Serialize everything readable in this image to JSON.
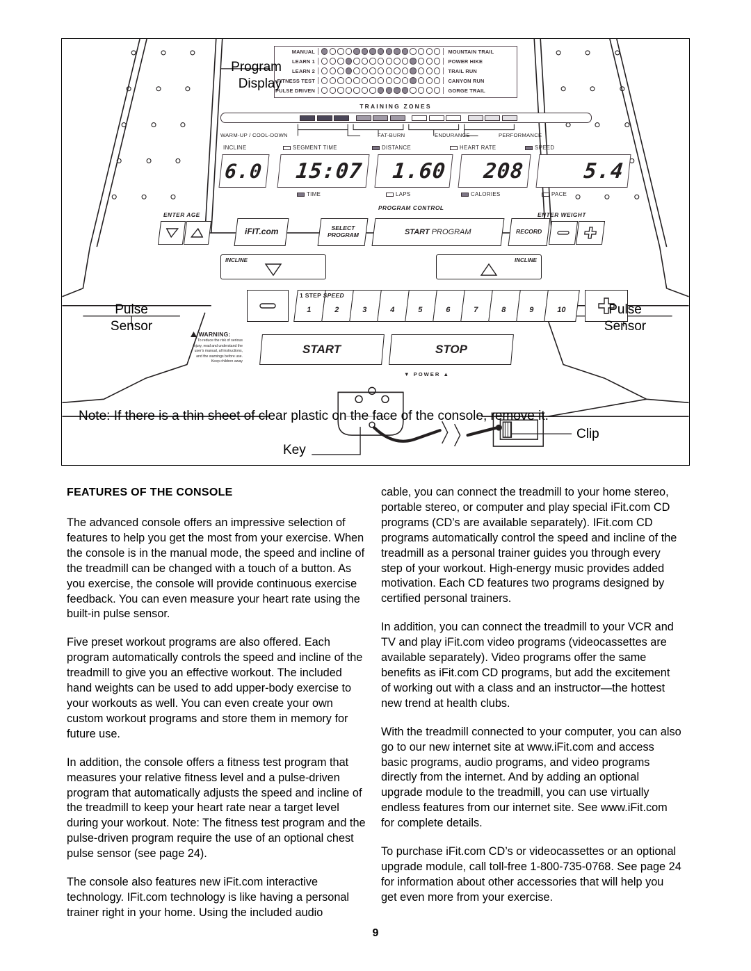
{
  "page": {
    "number": "9"
  },
  "heading": "FEATURES OF THE CONSOLE",
  "diagram": {
    "labels": {
      "program_display_line1": "Program",
      "program_display_line2": "Display",
      "pulse_sensor_line1": "Pulse",
      "pulse_sensor_line2": "Sensor",
      "key": "Key",
      "clip": "Clip"
    },
    "note": "Note: If there is a thin sheet of clear plastic on the face of the console, remove it.",
    "program_display": {
      "left_labels": [
        "MANUAL",
        "LEARN 1",
        "LEARN 2",
        "FITNESS TEST",
        "PULSE DRIVEN"
      ],
      "right_labels": [
        "MOUNTAIN TRAIL",
        "POWER HIKE",
        "TRAIL RUN",
        "CANYON RUN",
        "GORGE TRAIL"
      ],
      "matrix": [
        [
          1,
          0,
          0,
          0,
          1,
          1,
          1,
          1,
          1,
          1,
          1,
          0,
          0,
          0,
          0
        ],
        [
          0,
          0,
          0,
          1,
          0,
          0,
          0,
          0,
          0,
          0,
          0,
          1,
          0,
          0,
          0
        ],
        [
          0,
          0,
          0,
          1,
          0,
          0,
          0,
          0,
          0,
          0,
          0,
          1,
          0,
          0,
          0
        ],
        [
          0,
          0,
          0,
          0,
          0,
          0,
          0,
          0,
          0,
          0,
          0,
          1,
          0,
          0,
          0
        ],
        [
          0,
          0,
          0,
          0,
          0,
          0,
          0,
          1,
          1,
          1,
          1,
          0,
          0,
          0,
          0
        ]
      ]
    },
    "training_zones": {
      "title": "TRAINING ZONES",
      "zones": [
        "WARM-UP / COOL-DOWN",
        "FAT-BURN",
        "ENDURANCE",
        "PERFORMANCE"
      ]
    },
    "readouts": {
      "top": [
        {
          "label": "INCLINE",
          "indicator": "none"
        },
        {
          "label": "SEGMENT TIME",
          "indicator": "hollow"
        },
        {
          "label": "DISTANCE",
          "indicator": "filled"
        },
        {
          "label": "HEART RATE",
          "indicator": "hollow"
        },
        {
          "label": "SPEED",
          "indicator": "filled"
        }
      ],
      "bottom": [
        {
          "label": "",
          "indicator": "none"
        },
        {
          "label": "TIME",
          "indicator": "filled"
        },
        {
          "label": "LAPS",
          "indicator": "hollow"
        },
        {
          "label": "CALORIES",
          "indicator": "filled"
        },
        {
          "label": "PACE",
          "indicator": "hollow"
        }
      ],
      "values": [
        "6.0",
        "15:07",
        "1.60",
        "208",
        "5.4"
      ]
    },
    "controls": {
      "enter_age_caption": "ENTER AGE",
      "enter_weight_caption": "ENTER WEIGHT",
      "program_control_caption": "PROGRAM CONTROL",
      "ifit_logo": "iFIT.com",
      "select_program_line1": "SELECT",
      "select_program_line2": "PROGRAM",
      "start_program_bold": "START",
      "start_program_rest": " PROGRAM",
      "record": "RECORD",
      "incline_left": "INCLINE",
      "incline_right": "INCLINE",
      "step_speed_prefix": "1 STEP",
      "step_speed_word": "SPEED",
      "speed_buttons": [
        "1",
        "2",
        "3",
        "4",
        "5",
        "6",
        "7",
        "8",
        "9",
        "10"
      ],
      "start": "START",
      "stop": "STOP",
      "power": "POWER"
    },
    "warning": {
      "title": "WARNING:",
      "body": "To reduce the risk of serious injury, read and understand the user's manual, all instructions, and the warnings before use.  Keep children away"
    }
  },
  "body": {
    "left_column": [
      "The advanced console offers an impressive selection of features to help you get the most from your exercise. When the console is in the manual mode, the speed and incline of the treadmill can be changed with a touch of a button. As you exercise, the console will provide continuous exercise feedback. You can even measure your heart rate using the built-in pulse sensor.",
      "Five preset workout programs are also offered. Each program automatically controls the speed and incline of the treadmill to give you an effective workout. The included hand weights can be used to add upper-body exercise to your workouts as well. You can even create your own custom workout programs and store them in memory for future use.",
      "In addition, the console offers a fitness test program that measures your relative fitness level and a pulse-driven program that automatically adjusts the speed and incline of the treadmill to keep your heart rate near a target level during your workout. Note: The fitness test program and the pulse-driven program require the use of an optional chest pulse sensor (see page 24).",
      "The console also features new iFit.com interactive technology. IFit.com technology is like having a personal trainer right in your home. Using the included audio"
    ],
    "right_column": [
      "cable, you can connect the treadmill to your home stereo, portable stereo, or computer and play special iFit.com CD programs (CD’s are available separately). IFit.com CD programs automatically control the speed and incline of the treadmill as a personal trainer guides you through every step of your workout. High-energy music provides added motivation. Each CD features two programs designed by certified personal trainers.",
      "In addition, you can connect the treadmill to your VCR and TV and play iFit.com video programs (videocassettes are available separately). Video programs offer the same benefits as iFit.com CD programs, but add the excitement of working out with a class and an instructor—the hottest new trend at health clubs.",
      "With the treadmill connected to your computer, you can also go to our new internet site at www.iFit.com and access basic programs, audio programs, and video programs directly from the internet. And by adding an optional upgrade module to the treadmill, you can use virtually endless features from our internet site. See www.iFit.com for complete details.",
      "To purchase iFit.com CD’s or videocassettes or an optional upgrade module, call toll-free 1-800-735-0768. See page 24 for information about other accessories that will help you get even more from your exercise."
    ]
  }
}
